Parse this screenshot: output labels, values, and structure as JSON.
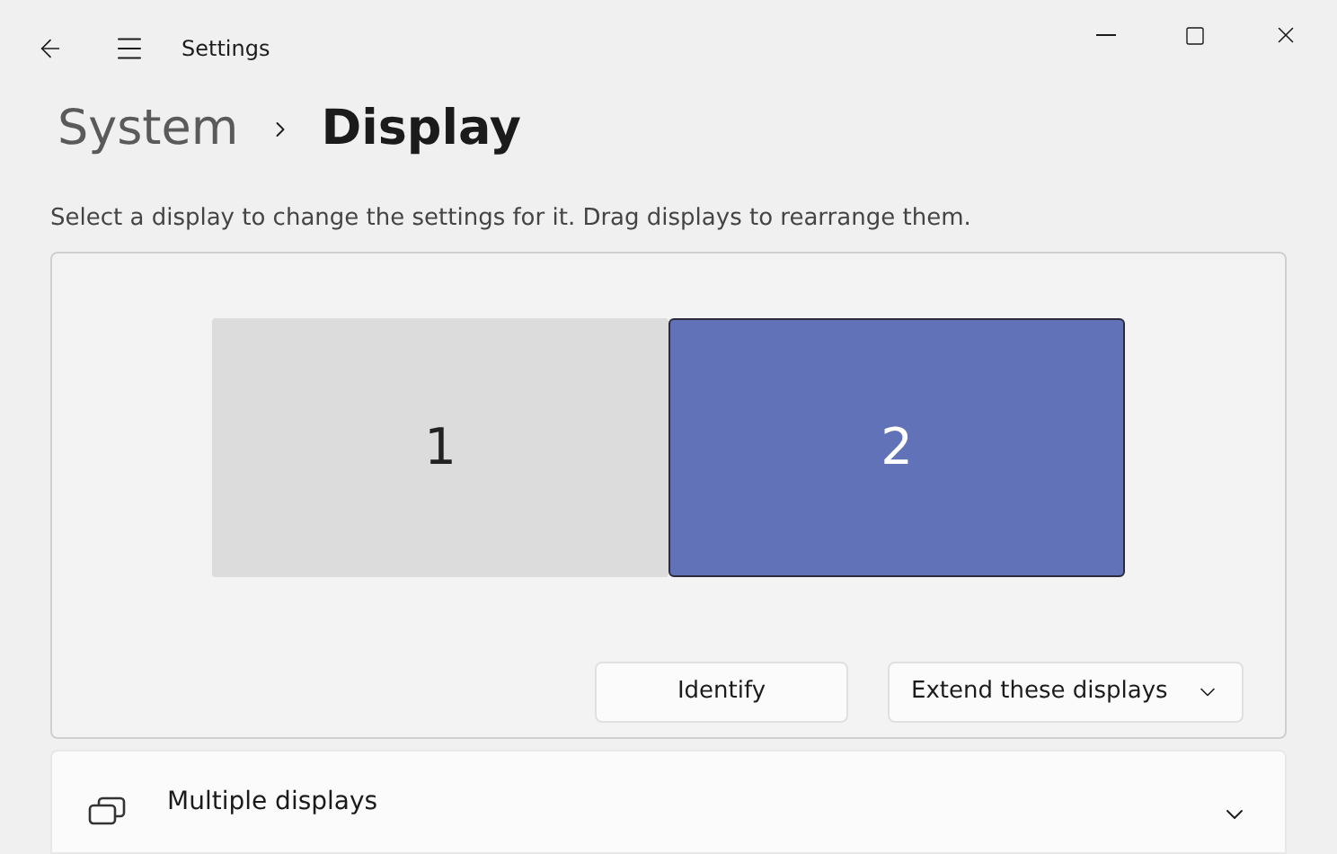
{
  "window": {
    "title": "Settings"
  },
  "breadcrumb": {
    "parent": "System",
    "current": "Display"
  },
  "description": "Select a display to change the settings for it. Drag displays to rearrange them.",
  "monitors": [
    {
      "label": "1",
      "selected": false
    },
    {
      "label": "2",
      "selected": true
    }
  ],
  "identify_button": "Identify",
  "mode_dropdown": {
    "value": "Extend these displays"
  },
  "sections": [
    {
      "title": "Multiple displays",
      "expanded": false
    }
  ]
}
